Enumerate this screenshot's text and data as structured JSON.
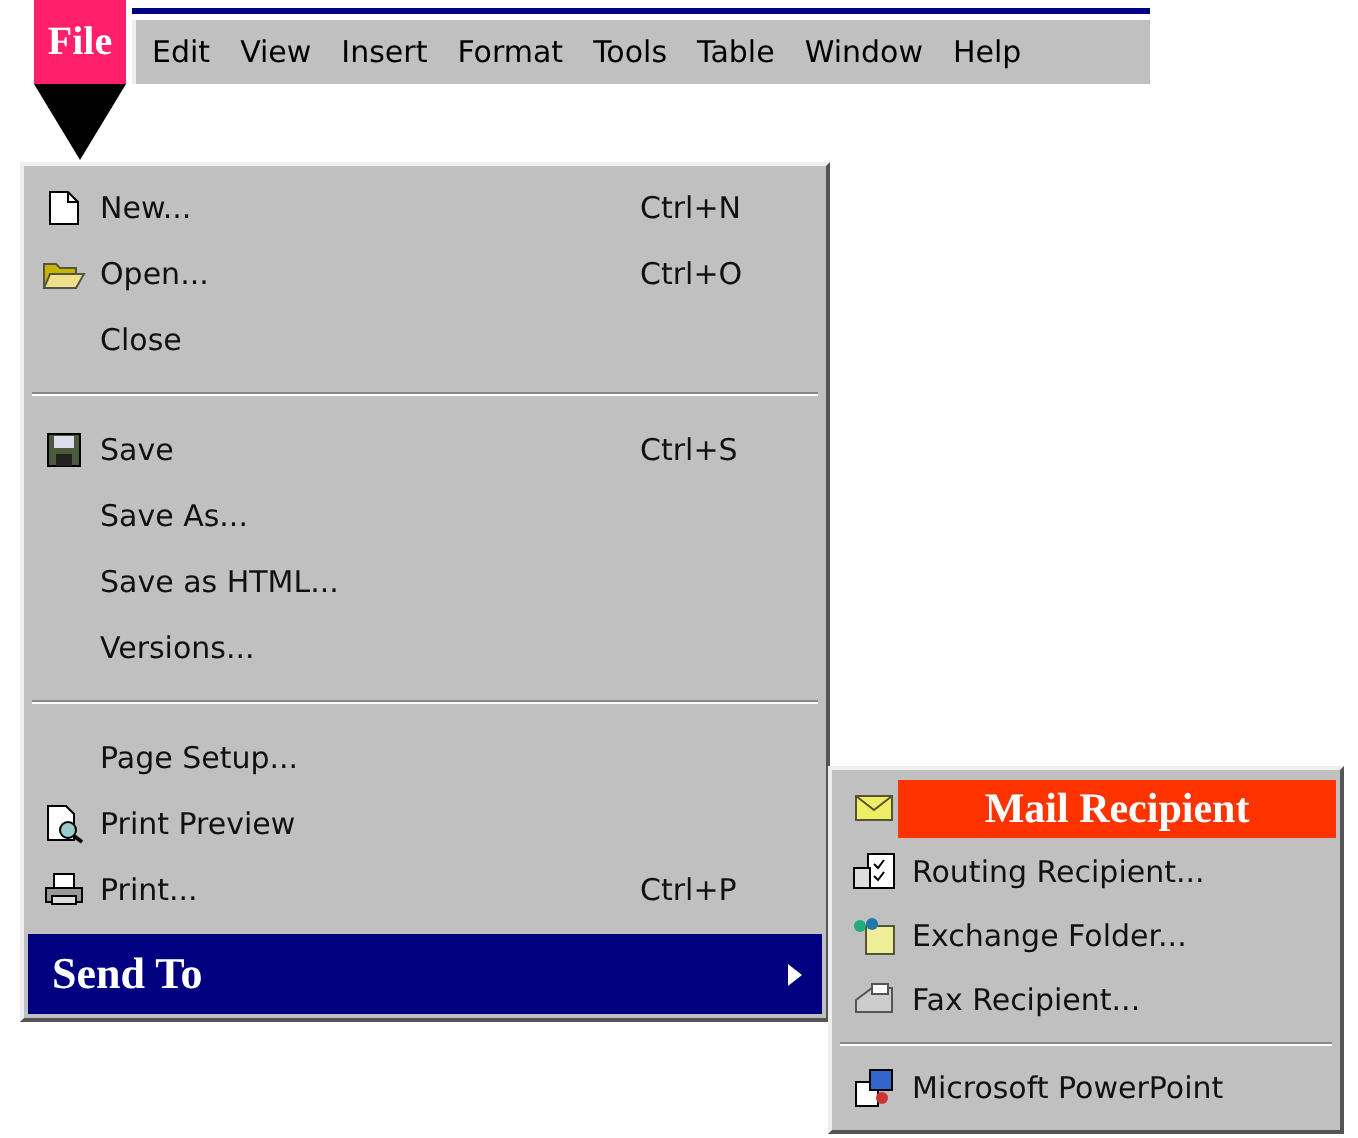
{
  "menu_bar": {
    "items": [
      {
        "label": "File",
        "selected": true
      },
      {
        "label": "Edit",
        "selected": false
      },
      {
        "label": "View",
        "selected": false
      },
      {
        "label": "Insert",
        "selected": false
      },
      {
        "label": "Format",
        "selected": false
      },
      {
        "label": "Tools",
        "selected": false
      },
      {
        "label": "Table",
        "selected": false
      },
      {
        "label": "Window",
        "selected": false
      },
      {
        "label": "Help",
        "selected": false
      }
    ]
  },
  "file_menu": {
    "items": [
      {
        "kind": "item",
        "label": "New...",
        "shortcut": "Ctrl+N",
        "selected": false
      },
      {
        "kind": "item",
        "label": "Open...",
        "shortcut": "Ctrl+O",
        "selected": false
      },
      {
        "kind": "item",
        "label": "Close",
        "selected": false
      },
      {
        "kind": "separator"
      },
      {
        "kind": "item",
        "label": "Save",
        "shortcut": "Ctrl+S",
        "selected": false
      },
      {
        "kind": "item",
        "label": "Save As...",
        "selected": false
      },
      {
        "kind": "item",
        "label": "Save as HTML...",
        "selected": false
      },
      {
        "kind": "item",
        "label": "Versions...",
        "selected": false
      },
      {
        "kind": "separator"
      },
      {
        "kind": "item",
        "label": "Page Setup...",
        "selected": false
      },
      {
        "kind": "item",
        "label": "Print Preview",
        "selected": false
      },
      {
        "kind": "item",
        "label": "Print...",
        "shortcut": "Ctrl+P",
        "selected": false
      },
      {
        "kind": "submenu",
        "label": "Send To",
        "selected": true
      }
    ]
  },
  "send_to_menu": {
    "items": [
      {
        "kind": "item",
        "label": "Mail Recipient",
        "selected": true
      },
      {
        "kind": "item",
        "label": "Routing Recipient...",
        "selected": false
      },
      {
        "kind": "item",
        "label": "Exchange Folder...",
        "selected": false
      },
      {
        "kind": "item",
        "label": "Fax Recipient...",
        "selected": false
      },
      {
        "kind": "separator"
      },
      {
        "kind": "item",
        "label": "Microsoft PowerPoint",
        "selected": false
      }
    ]
  }
}
